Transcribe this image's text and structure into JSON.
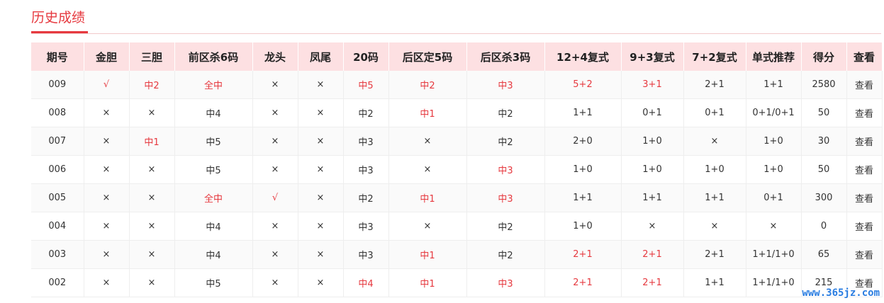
{
  "section": {
    "title": "历史成绩"
  },
  "table": {
    "headers": [
      "期号",
      "金胆",
      "三胆",
      "前区杀6码",
      "龙头",
      "凤尾",
      "20码",
      "后区定5码",
      "后区杀3码",
      "12+4复式",
      "9+3复式",
      "7+2复式",
      "单式推荐",
      "得分",
      "查看"
    ],
    "rows": [
      {
        "cells": [
          "009",
          "√",
          "中2",
          "全中",
          "×",
          "×",
          "中5",
          "中2",
          "中3",
          "5+2",
          "3+1",
          "2+1",
          "1+1",
          "2580",
          "查看"
        ],
        "red": [
          1,
          2,
          3,
          6,
          7,
          8,
          9,
          10
        ]
      },
      {
        "cells": [
          "008",
          "×",
          "×",
          "中4",
          "×",
          "×",
          "中2",
          "中1",
          "中2",
          "1+1",
          "0+1",
          "0+1",
          "0+1/0+1",
          "50",
          "查看"
        ],
        "red": [
          7
        ]
      },
      {
        "cells": [
          "007",
          "×",
          "中1",
          "中5",
          "×",
          "×",
          "中3",
          "×",
          "中2",
          "2+0",
          "1+0",
          "×",
          "1+0",
          "30",
          "查看"
        ],
        "red": [
          2
        ]
      },
      {
        "cells": [
          "006",
          "×",
          "×",
          "中5",
          "×",
          "×",
          "中3",
          "×",
          "中3",
          "1+0",
          "1+0",
          "1+0",
          "1+0",
          "50",
          "查看"
        ],
        "red": [
          8
        ]
      },
      {
        "cells": [
          "005",
          "×",
          "×",
          "全中",
          "√",
          "×",
          "中2",
          "中1",
          "中3",
          "1+1",
          "1+1",
          "1+1",
          "0+1",
          "300",
          "查看"
        ],
        "red": [
          3,
          4,
          7,
          8
        ]
      },
      {
        "cells": [
          "004",
          "×",
          "×",
          "中4",
          "×",
          "×",
          "中3",
          "×",
          "中2",
          "1+0",
          "×",
          "×",
          "×",
          "0",
          "查看"
        ],
        "red": []
      },
      {
        "cells": [
          "003",
          "×",
          "×",
          "中4",
          "×",
          "×",
          "中3",
          "中1",
          "中2",
          "2+1",
          "2+1",
          "2+1",
          "1+1/1+0",
          "65",
          "查看"
        ],
        "red": [
          7,
          9,
          10
        ]
      },
      {
        "cells": [
          "002",
          "×",
          "×",
          "中5",
          "×",
          "×",
          "中4",
          "中1",
          "中3",
          "2+1",
          "2+1",
          "1+1",
          "1+1/1+0",
          "215",
          "查看"
        ],
        "red": [
          6,
          7,
          8,
          9,
          10
        ]
      }
    ]
  },
  "watermark": "www.365jz.com",
  "colors": {
    "accent": "#e6393f",
    "header_bg": "#fde0e2",
    "watermark": "#2a7de1"
  }
}
